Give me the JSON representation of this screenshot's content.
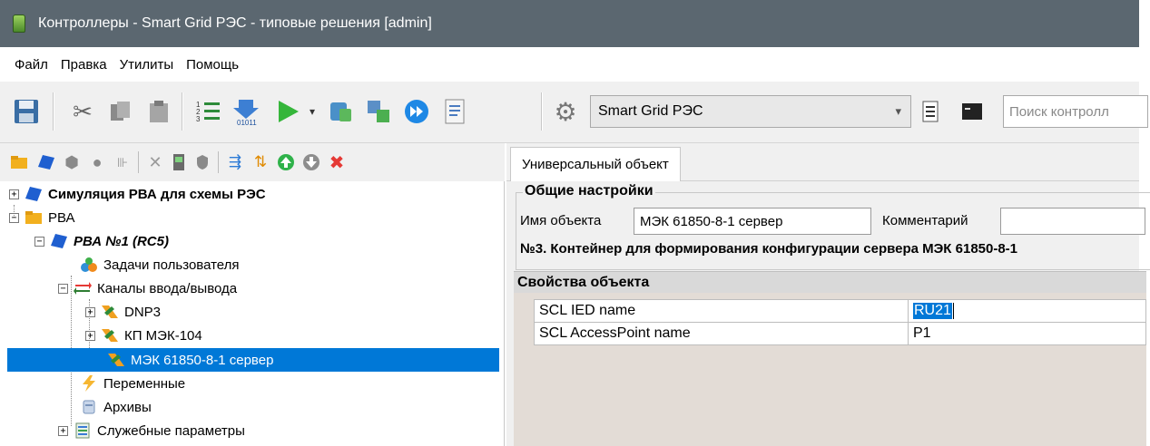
{
  "window": {
    "title": "Контроллеры - Smart Grid РЭС - типовые решения [admin]"
  },
  "menu": {
    "items": [
      "Файл",
      "Правка",
      "Утилиты",
      "Помощь"
    ]
  },
  "toolbar": {
    "project_select": "Smart Grid РЭС",
    "search_placeholder": "Поиск контролл"
  },
  "tree": {
    "items": [
      {
        "label": "Симуляция РВА для схемы РЭС",
        "icon": "controller-icon"
      },
      {
        "label": "РВА",
        "icon": "folder-icon"
      },
      {
        "label": "РВА №1 (RC5)",
        "icon": "controller-icon"
      },
      {
        "label": "Задачи пользователя",
        "icon": "tasks-icon"
      },
      {
        "label": "Каналы ввода/вывода",
        "icon": "io-channels-icon"
      },
      {
        "label": "DNP3",
        "icon": "channel-icon"
      },
      {
        "label": "КП МЭК-104",
        "icon": "channel-icon"
      },
      {
        "label": "МЭК 61850-8-1 сервер",
        "icon": "channel-icon"
      },
      {
        "label": "Переменные",
        "icon": "variables-icon"
      },
      {
        "label": "Архивы",
        "icon": "archive-icon"
      },
      {
        "label": "Служебные параметры",
        "icon": "service-params-icon"
      }
    ]
  },
  "editor": {
    "tab": "Универсальный объект",
    "general_settings": "Общие настройки",
    "object_name_label": "Имя объекта",
    "object_name_value": "МЭК 61850-8-1 сервер",
    "comment_label": "Комментарий",
    "comment_value": "",
    "description": "№3. Контейнер для формирования конфигурации сервера МЭК 61850-8-1",
    "properties_header": "Свойства объекта",
    "properties": [
      {
        "name": "SCL IED name",
        "value": "RU21"
      },
      {
        "name": "SCL AccessPoint name",
        "value": "P1"
      }
    ]
  }
}
